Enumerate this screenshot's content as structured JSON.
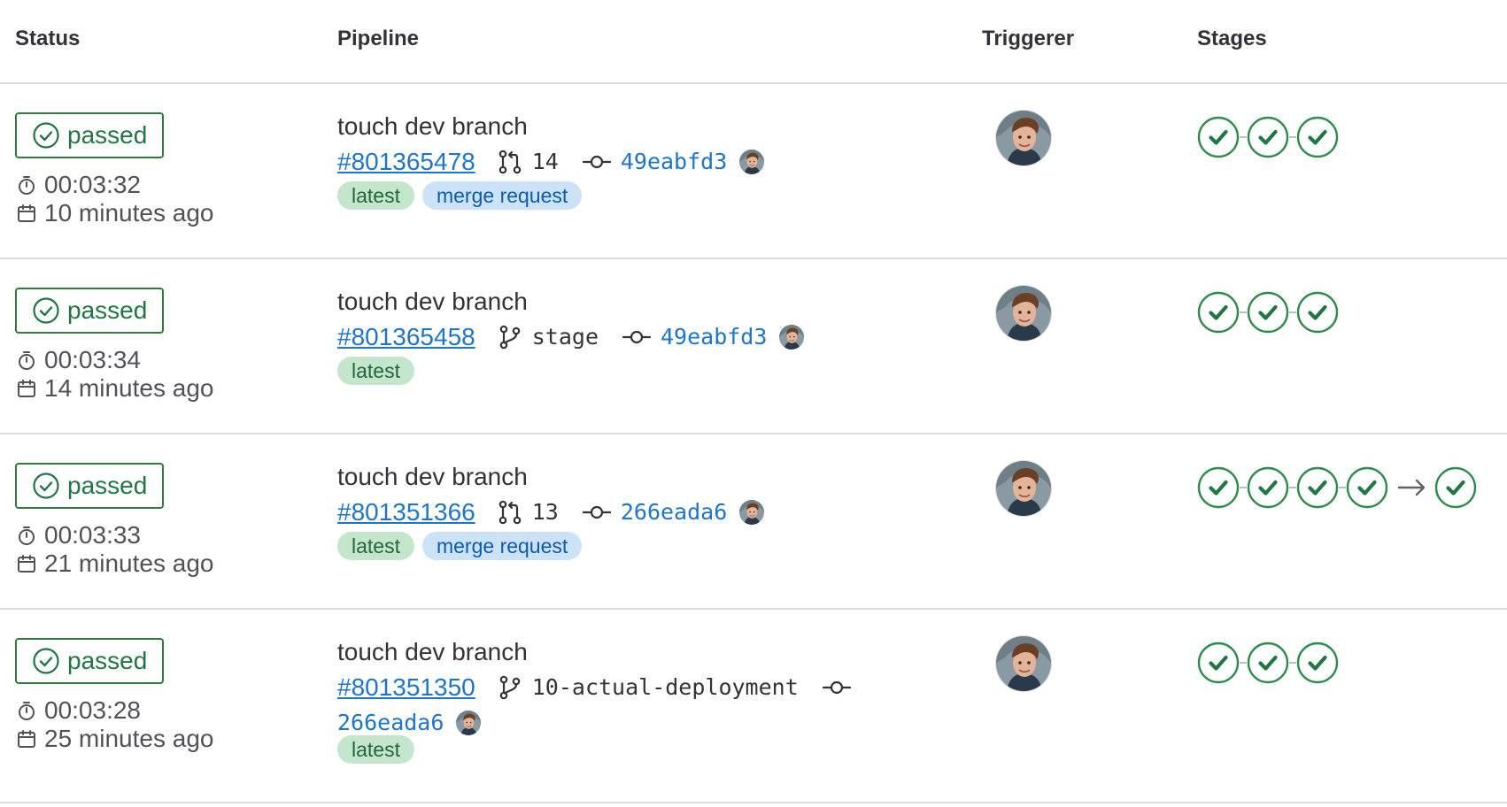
{
  "headers": {
    "status": "Status",
    "pipeline": "Pipeline",
    "triggerer": "Triggerer",
    "stages": "Stages"
  },
  "colors": {
    "success": "#217645",
    "link": "#1f75cb",
    "badge_green_bg": "#c3e6cd",
    "badge_blue_bg": "#cbe2f9"
  },
  "pipelines": [
    {
      "status": "passed",
      "duration": "00:03:32",
      "finished": "10 minutes ago",
      "title": "touch dev branch",
      "id": "#801365478",
      "ref_type": "merge-request",
      "ref": "14",
      "sha": "49eabfd3",
      "badges": [
        {
          "label": "latest",
          "color": "green"
        },
        {
          "label": "merge request",
          "color": "blue"
        }
      ],
      "stages": 3,
      "downstream": false
    },
    {
      "status": "passed",
      "duration": "00:03:34",
      "finished": "14 minutes ago",
      "title": "touch dev branch",
      "id": "#801365458",
      "ref_type": "branch",
      "ref": "stage",
      "sha": "49eabfd3",
      "badges": [
        {
          "label": "latest",
          "color": "green"
        }
      ],
      "stages": 3,
      "downstream": false
    },
    {
      "status": "passed",
      "duration": "00:03:33",
      "finished": "21 minutes ago",
      "title": "touch dev branch",
      "id": "#801351366",
      "ref_type": "merge-request",
      "ref": "13",
      "sha": "266eada6",
      "badges": [
        {
          "label": "latest",
          "color": "green"
        },
        {
          "label": "merge request",
          "color": "blue"
        }
      ],
      "stages": 4,
      "downstream": true
    },
    {
      "status": "passed",
      "duration": "00:03:28",
      "finished": "25 minutes ago",
      "title": "touch dev branch",
      "id": "#801351350",
      "ref_type": "branch",
      "ref": "10-actual-deployment",
      "sha": "266eada6",
      "badges": [
        {
          "label": "latest",
          "color": "green"
        }
      ],
      "stages": 3,
      "downstream": false
    }
  ]
}
